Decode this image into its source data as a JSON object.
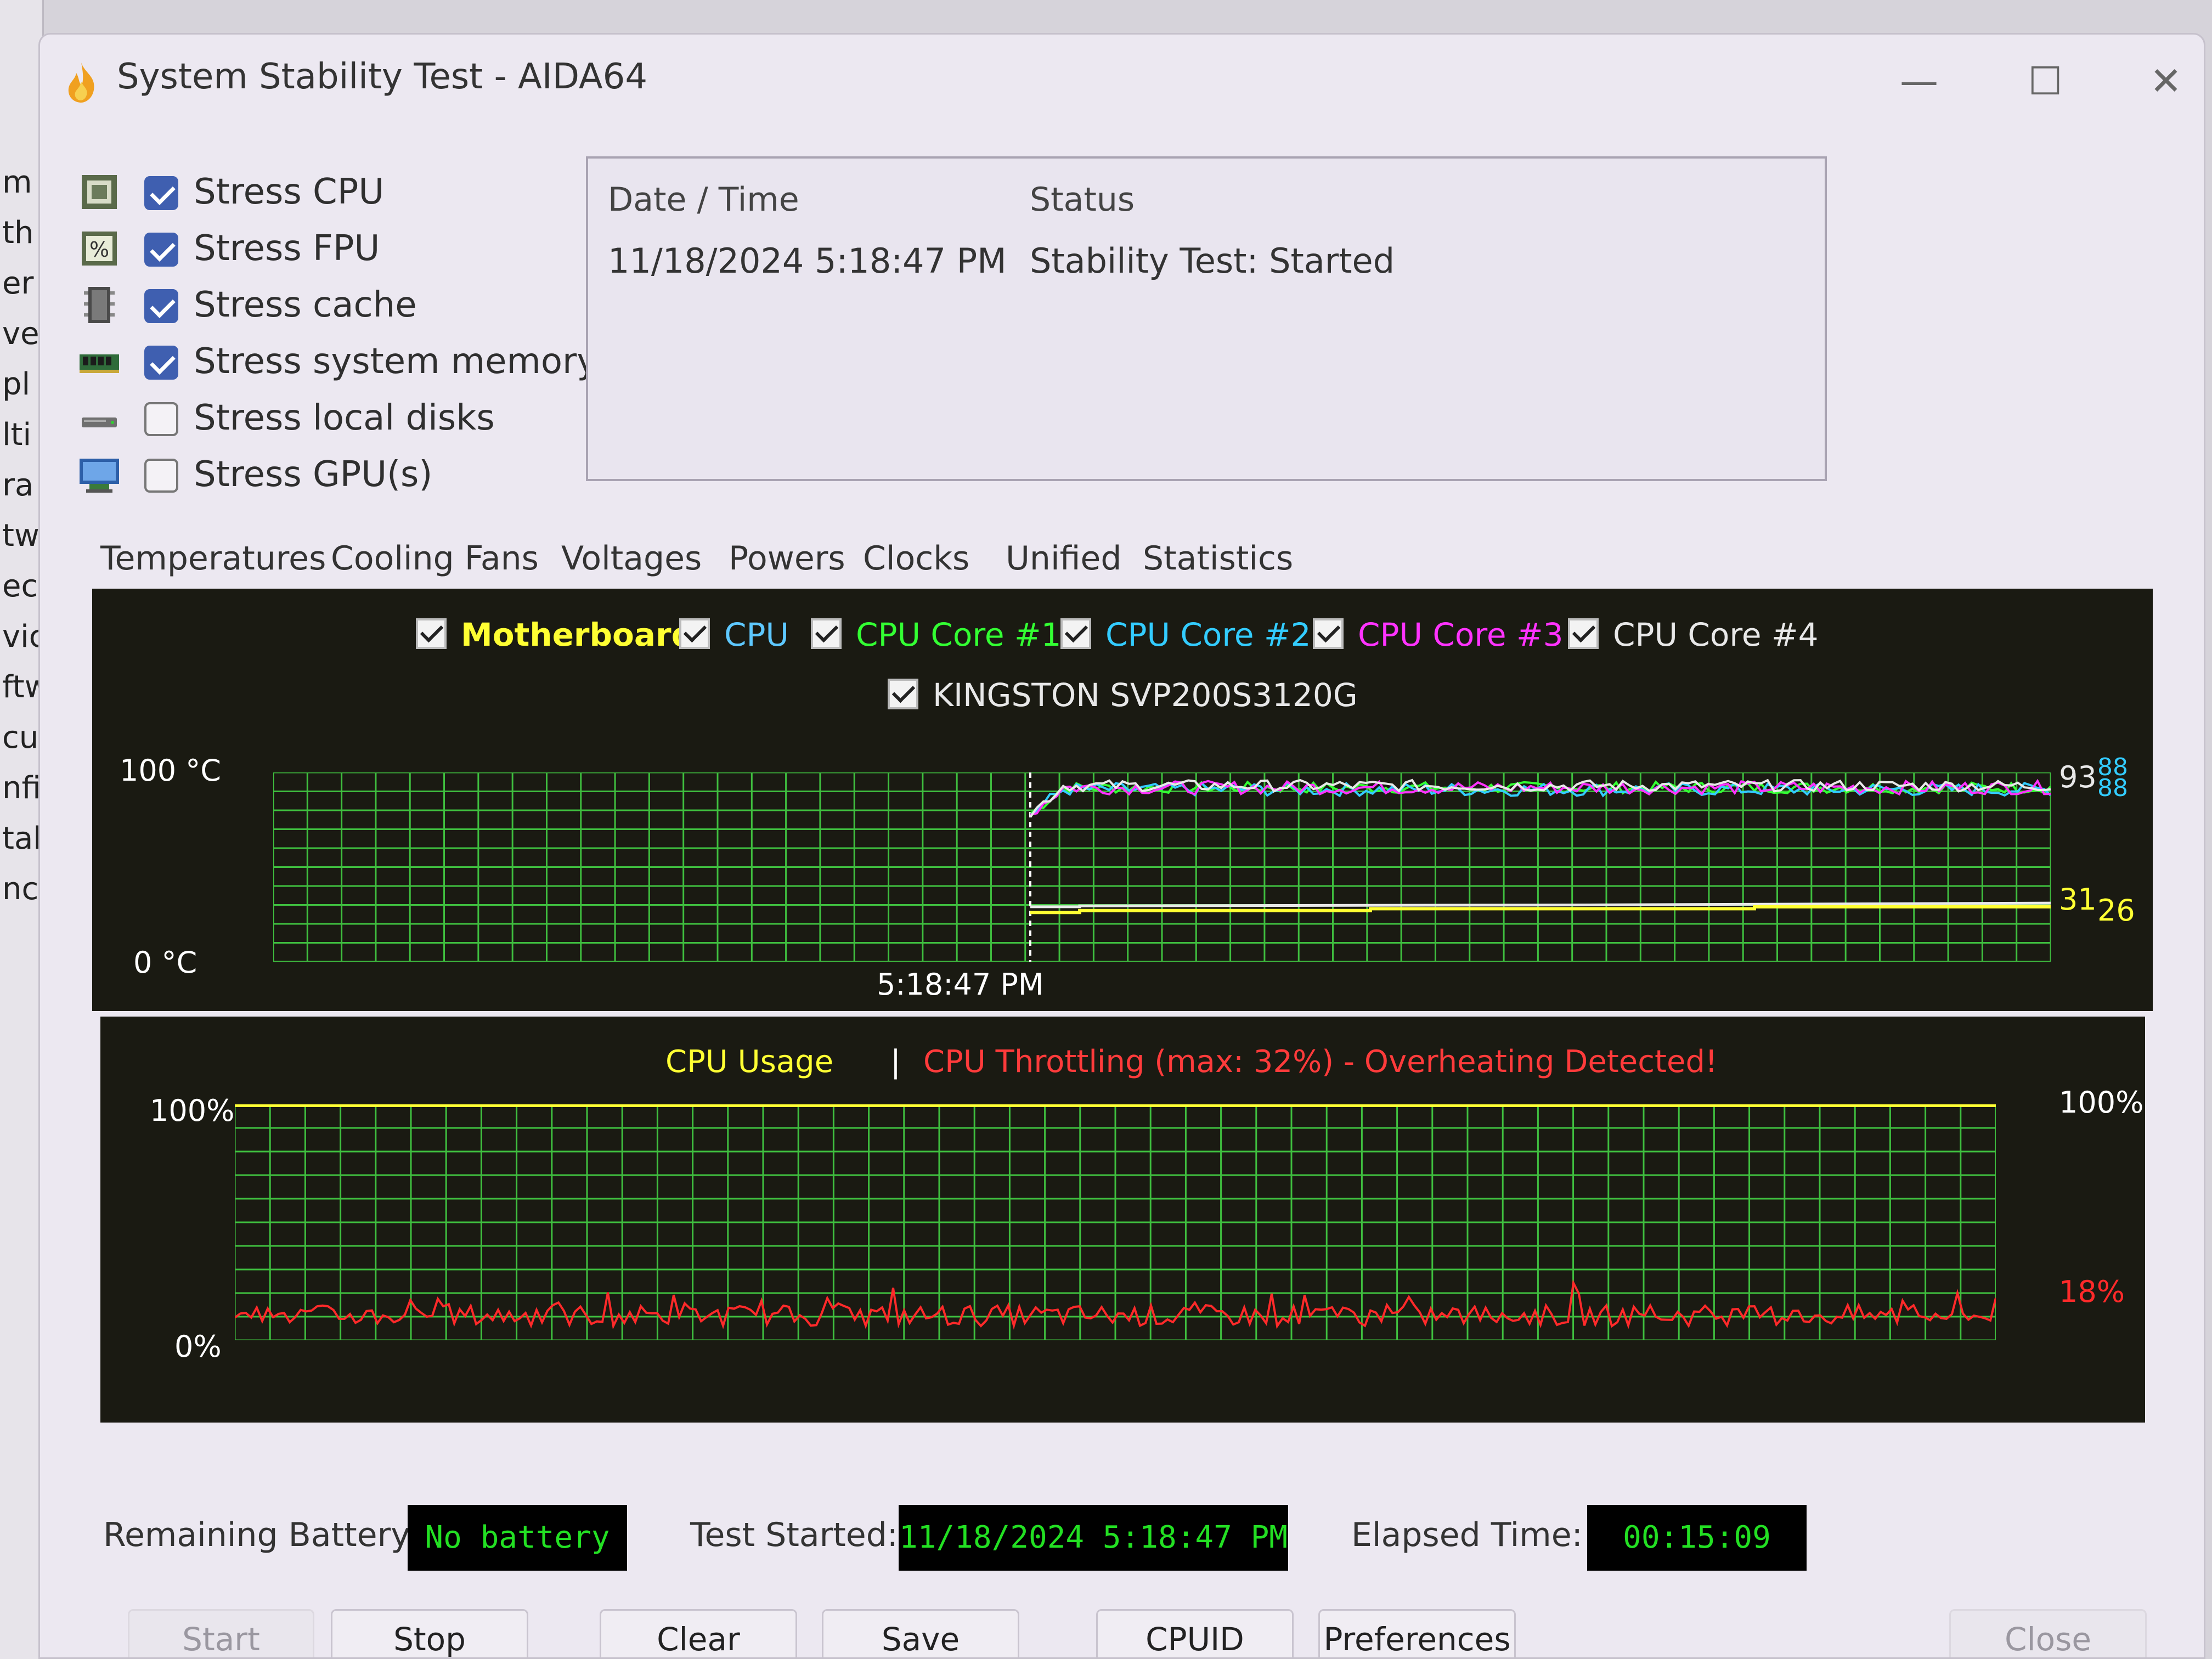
{
  "window": {
    "title": "System Stability Test - AIDA64",
    "minimize": "—",
    "maximize": "☐",
    "close": "✕"
  },
  "background_app": {
    "fragments": [
      "m",
      "th",
      "er",
      "ve",
      "pl",
      "lti",
      "ra",
      "tw",
      "ec",
      "vic",
      "ftw",
      "cu",
      "nfi",
      "tal",
      "ncl"
    ]
  },
  "stress_options": [
    {
      "label": "Stress CPU",
      "checked": true,
      "icon": "cpu-icon"
    },
    {
      "label": "Stress FPU",
      "checked": true,
      "icon": "fpu-icon"
    },
    {
      "label": "Stress cache",
      "checked": true,
      "icon": "cache-icon"
    },
    {
      "label": "Stress system memory",
      "checked": true,
      "icon": "memory-icon"
    },
    {
      "label": "Stress local disks",
      "checked": false,
      "icon": "disk-icon"
    },
    {
      "label": "Stress GPU(s)",
      "checked": false,
      "icon": "gpu-icon"
    }
  ],
  "log": {
    "headers": {
      "datetime": "Date / Time",
      "status": "Status"
    },
    "rows": [
      {
        "datetime": "11/18/2024 5:18:47 PM",
        "status": "Stability Test: Started"
      }
    ]
  },
  "tabs": [
    "Temperatures",
    "Cooling Fans",
    "Voltages",
    "Powers",
    "Clocks",
    "Unified",
    "Statistics"
  ],
  "temperature_graph": {
    "legend": [
      {
        "label": "Motherboard",
        "color": "#ffff33",
        "bold": true
      },
      {
        "label": "CPU",
        "color": "#5ec8ff"
      },
      {
        "label": "CPU Core #1",
        "color": "#33ff33"
      },
      {
        "label": "CPU Core #2",
        "color": "#33ccff"
      },
      {
        "label": "CPU Core #3",
        "color": "#ff33ff"
      },
      {
        "label": "CPU Core #4",
        "color": "#e8e8e8"
      },
      {
        "label": "KINGSTON SVP200S3120G",
        "color": "#e8e8e8"
      }
    ],
    "y_max_label": "100 °C",
    "y_min_label": "0 °C",
    "time_label": "5:18:47 PM",
    "readouts": {
      "r1": "93",
      "r2": "88",
      "r3": "88",
      "r4": "31",
      "r5": "26"
    }
  },
  "usage_graph": {
    "title_usage": "CPU Usage",
    "separator": "|",
    "title_throttle": "CPU Throttling (max: 32%) - Overheating Detected!",
    "y_max_label": "100%",
    "y_min_label": "0%",
    "right_max": "100%",
    "right_current": "18%"
  },
  "status": {
    "battery_label": "Remaining Battery:",
    "battery_value": "No battery",
    "started_label": "Test Started:",
    "started_value": "11/18/2024 5:18:47 PM",
    "elapsed_label": "Elapsed Time:",
    "elapsed_value": "00:15:09"
  },
  "buttons": {
    "start": "Start",
    "stop": "Stop",
    "clear": "Clear",
    "save": "Save",
    "cpuid": "CPUID",
    "preferences": "Preferences",
    "close": "Close"
  },
  "colors": {
    "grid": "#3fbf3f",
    "usage_line": "#ff2a2a",
    "throttle_text": "#ff3b3b",
    "usage_title": "#ffff33",
    "status_text": "#23e023"
  }
}
